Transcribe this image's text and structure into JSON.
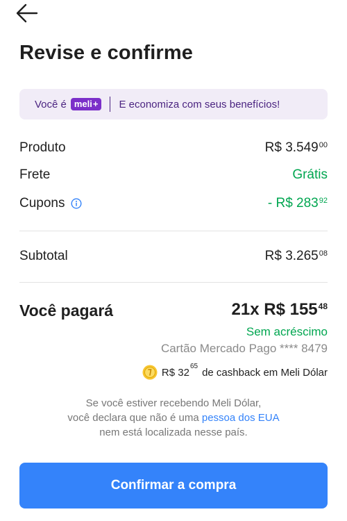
{
  "header": {
    "back_icon": "arrow-left-icon",
    "title": "Revise e confirme"
  },
  "meli_banner": {
    "prefix": "Você é",
    "badge_text": "meli",
    "badge_plus": "+",
    "message": "E economiza com seus benefícios!",
    "badge_color": "#7b2fc9",
    "background_color": "#f1ecf7"
  },
  "summary": {
    "produto": {
      "label": "Produto",
      "amount": "R$ 3.549",
      "cents": "00"
    },
    "frete": {
      "label": "Frete",
      "value": "Grátis"
    },
    "cupons": {
      "label": "Cupons",
      "icon": "info-icon",
      "amount": "- R$ 283",
      "cents": "92"
    },
    "subtotal": {
      "label": "Subtotal",
      "amount": "R$ 3.265",
      "cents": "08"
    }
  },
  "total": {
    "label": "Você pagará",
    "installments": "21x R$ 155",
    "cents": "48",
    "interest_note": "Sem acréscimo",
    "card": "Cartão Mercado Pago **** 8479"
  },
  "cashback": {
    "icon": "coin-icon",
    "amount": "R$ 32",
    "cents": "65",
    "text": "de cashback em Meli Dólar"
  },
  "disclaimer": {
    "line1": "Se você estiver recebendo Meli Dólar,",
    "line2_before": "você declara que não é uma ",
    "line2_link": "pessoa dos EUA",
    "line3": "nem está localizada nesse país."
  },
  "confirm_button": {
    "label": "Confirmar a compra",
    "color": "#3483fa"
  },
  "colors": {
    "green": "#00a650",
    "link": "#3483fa"
  }
}
